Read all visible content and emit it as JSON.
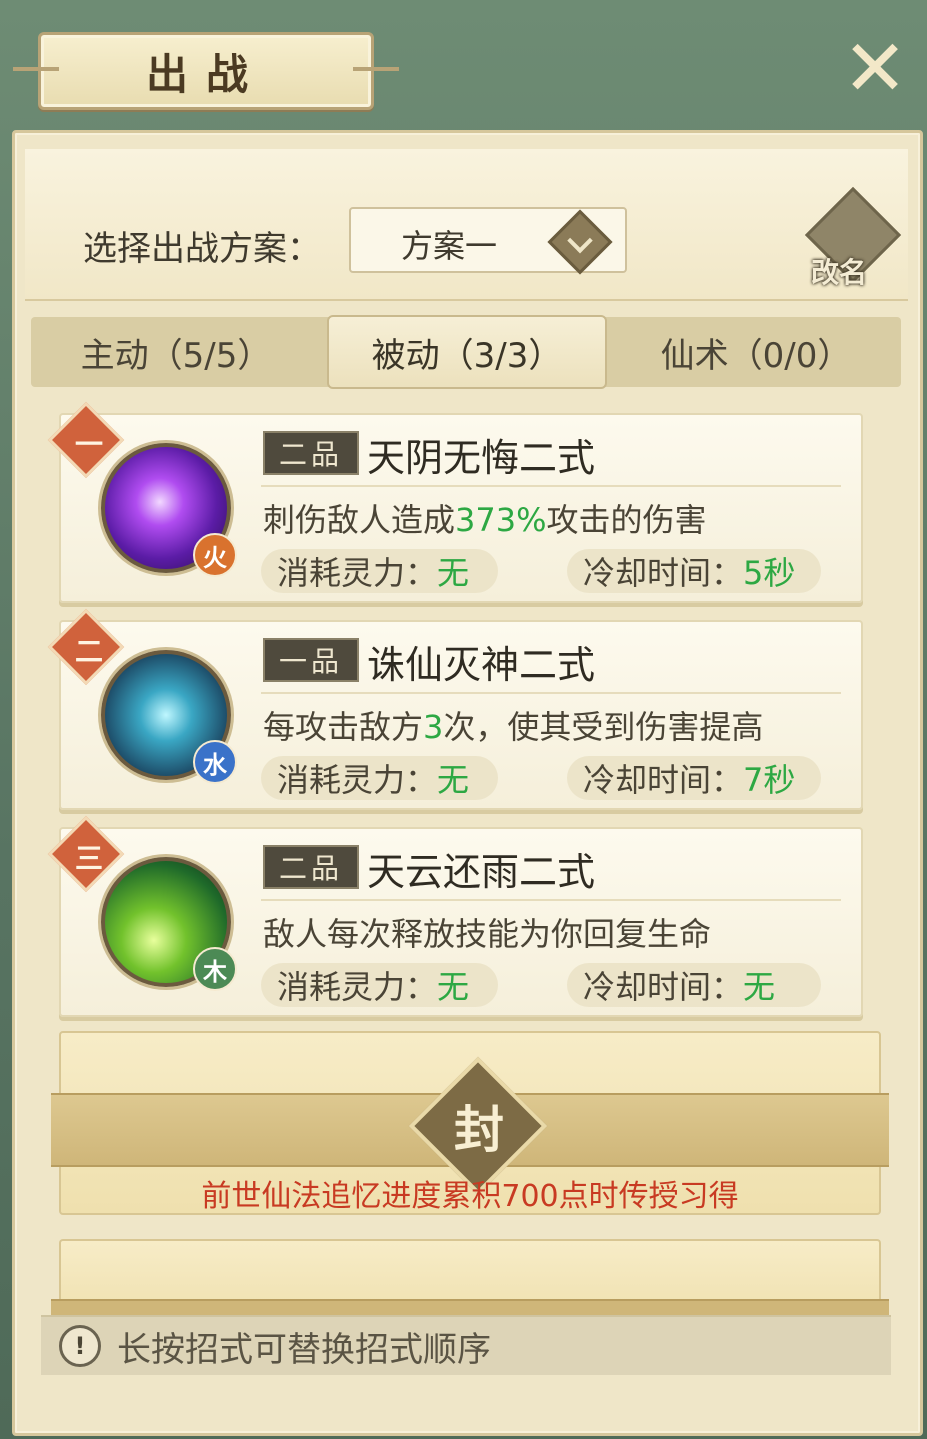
{
  "header": {
    "title": "出战"
  },
  "plan": {
    "label": "选择出战方案：",
    "selected": "方案一",
    "rename_label": "改名"
  },
  "tabs": [
    {
      "label": "主动（5/5）",
      "active": false
    },
    {
      "label": "被动（3/3）",
      "active": true
    },
    {
      "label": "仙术（0/0）",
      "active": false
    }
  ],
  "skills": [
    {
      "order": "一",
      "grade": "二品",
      "name": "天阴无悔二式",
      "element": "火",
      "desc_pre": "刺伤敌人造成",
      "desc_hl": "373%",
      "desc_post": "攻击的伤害",
      "cost_label": "消耗灵力：",
      "cost_value": "无",
      "cd_label": "冷却时间：",
      "cd_value": "5秒"
    },
    {
      "order": "二",
      "grade": "一品",
      "name": "诛仙灭神二式",
      "element": "水",
      "desc_pre": "每攻击敌方",
      "desc_hl": "3",
      "desc_post": "次，使其受到伤害提高",
      "cost_label": "消耗灵力：",
      "cost_value": "无",
      "cd_label": "冷却时间：",
      "cd_value": "7秒"
    },
    {
      "order": "三",
      "grade": "二品",
      "name": "天云还雨二式",
      "element": "木",
      "desc_pre": "敌人每次释放技能为你回复生命",
      "desc_hl": "",
      "desc_post": "",
      "cost_label": "消耗灵力：",
      "cost_value": "无",
      "cd_label": "冷却时间：",
      "cd_value": "无"
    }
  ],
  "locked": {
    "emblem": "封",
    "hint": "前世仙法追忆进度累积700点时传授习得"
  },
  "tip": {
    "icon": "!",
    "text": "长按招式可替换招式顺序"
  },
  "colors": {
    "highlight": "#2da843",
    "warning_text": "#c83a22",
    "order_badge": "#d0623c"
  }
}
